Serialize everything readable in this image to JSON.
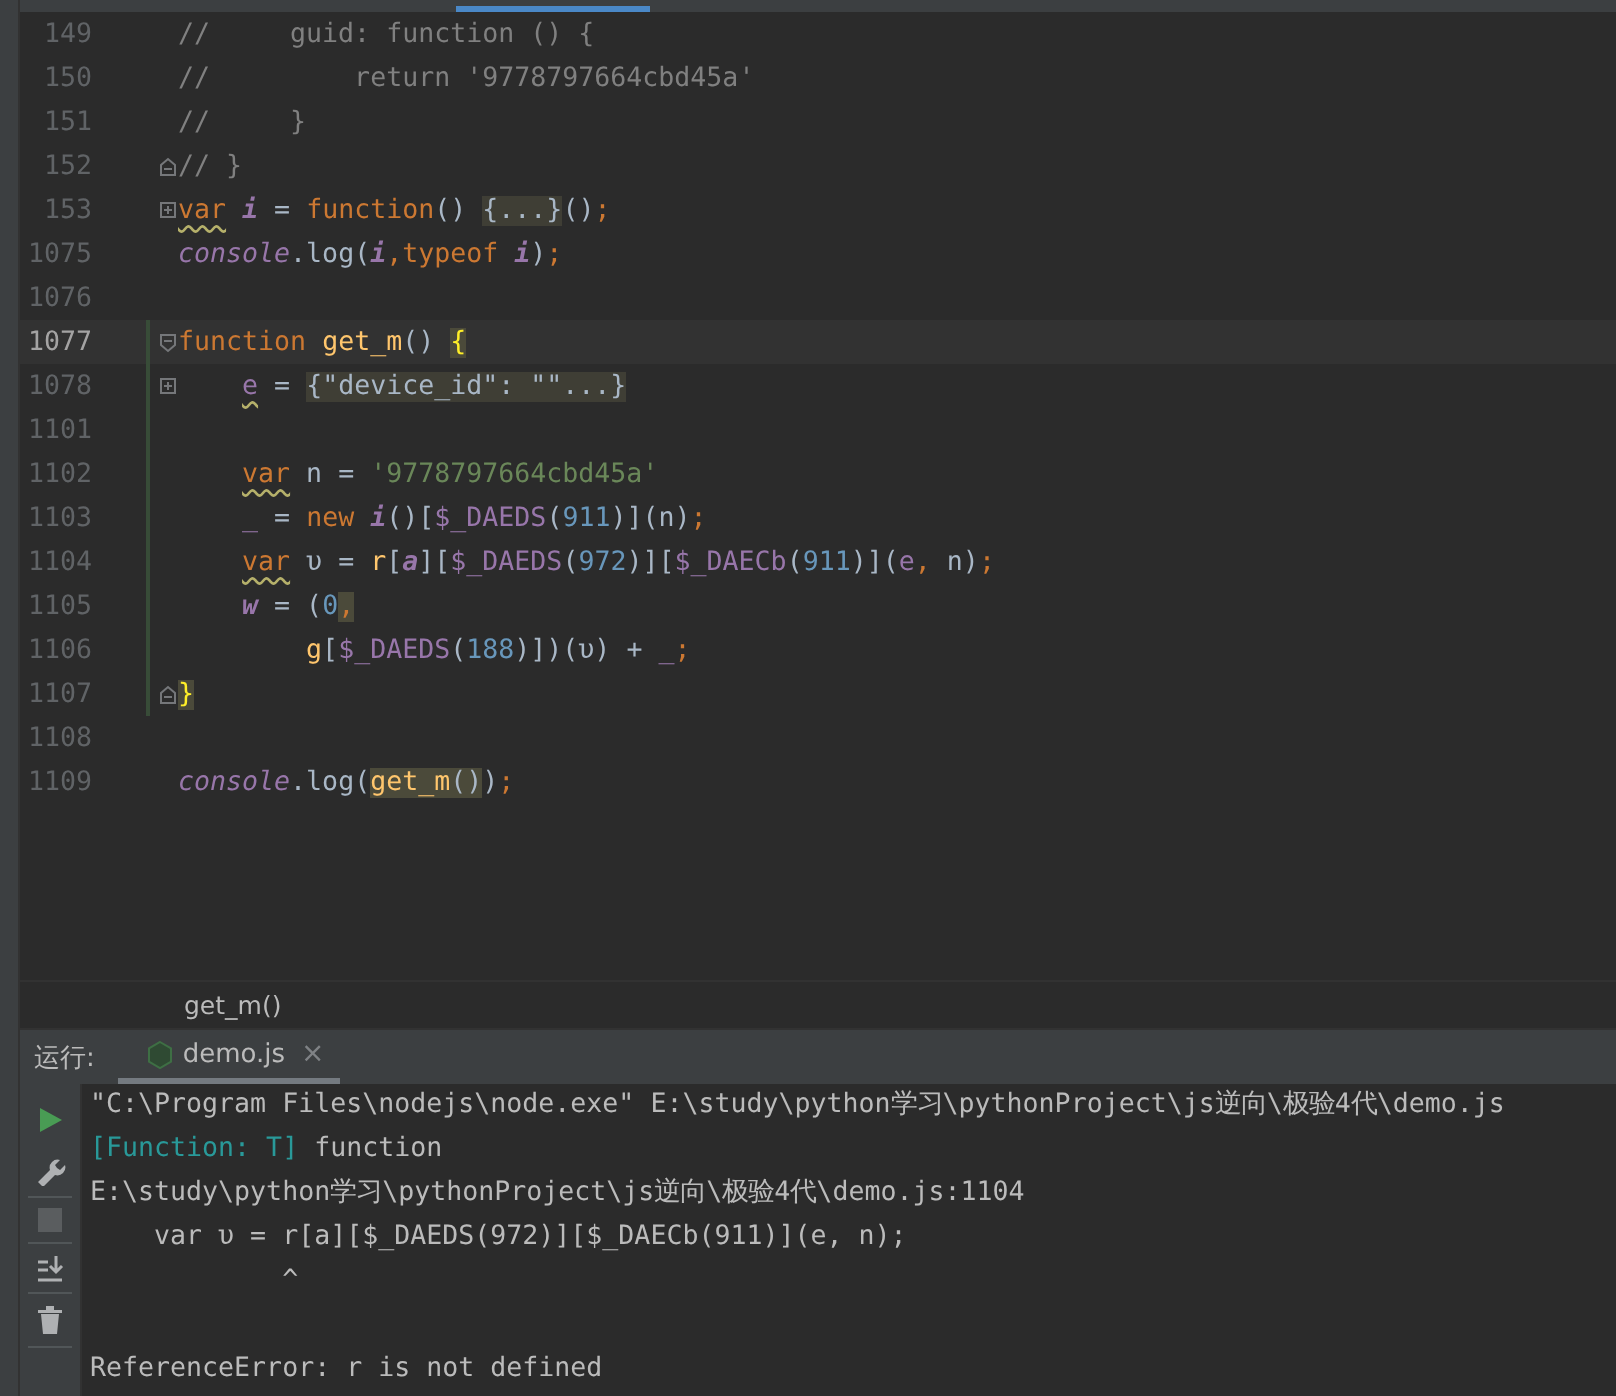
{
  "editor": {
    "lines": [
      {
        "number": "149",
        "current": false,
        "changed": false,
        "tokens": [
          {
            "text": "//     guid: function () {",
            "kind": "comment"
          }
        ]
      },
      {
        "number": "150",
        "current": false,
        "changed": false,
        "tokens": [
          {
            "text": "//         return '9778797664cbd45a'",
            "kind": "comment"
          }
        ]
      },
      {
        "number": "151",
        "current": false,
        "changed": false,
        "tokens": [
          {
            "text": "//     }",
            "kind": "comment"
          }
        ]
      },
      {
        "number": "152",
        "current": false,
        "changed": false,
        "fold": {
          "kind": "end"
        },
        "tokens": [
          {
            "text": "// }",
            "kind": "comment"
          }
        ]
      },
      {
        "number": "153",
        "current": false,
        "changed": false,
        "fold": {
          "kind": "expand"
        },
        "tokens": [
          {
            "text": "var",
            "kind": "keyword",
            "warning": true
          },
          {
            "text": " i",
            "kind": "local"
          },
          {
            "text": " = ",
            "kind": "text"
          },
          {
            "text": "function",
            "kind": "keyword"
          },
          {
            "text": "() ",
            "kind": "text"
          },
          {
            "text": "{...}",
            "kind": "folded"
          },
          {
            "text": "()",
            "kind": "text"
          },
          {
            "text": ";",
            "kind": "keyword"
          }
        ]
      },
      {
        "number": "1075",
        "current": false,
        "changed": false,
        "tokens": [
          {
            "text": "console",
            "kind": "global"
          },
          {
            "text": ".log(",
            "kind": "text"
          },
          {
            "text": "i",
            "kind": "local"
          },
          {
            "text": ",typeof ",
            "kind": "keyword"
          },
          {
            "text": "i",
            "kind": "local"
          },
          {
            "text": ")",
            "kind": "text"
          },
          {
            "text": ";",
            "kind": "keyword"
          }
        ]
      },
      {
        "number": "1076",
        "current": false,
        "changed": false
      },
      {
        "number": "1077",
        "current": true,
        "changed": true,
        "fold": {
          "kind": "collapse"
        },
        "tokens": [
          {
            "text": "function ",
            "kind": "keyword"
          },
          {
            "text": "get_m",
            "kind": "fn"
          },
          {
            "text": "() ",
            "kind": "text"
          },
          {
            "text": "{",
            "kind": "brace",
            "highlighted": true
          }
        ],
        "children": [
          {
            "number": "1078",
            "current": false,
            "changed": true,
            "fold": {
              "kind": "expand"
            },
            "tokens": [
              {
                "text": "e",
                "kind": "field",
                "warning": true
              },
              {
                "text": " = ",
                "kind": "text"
              },
              {
                "text": "{\"device_id\": \"\"...}",
                "kind": "folded"
              }
            ]
          },
          {
            "number": "1101",
            "current": false,
            "changed": true
          },
          {
            "number": "1102",
            "current": false,
            "changed": true,
            "tokens": [
              {
                "text": "var",
                "kind": "keyword",
                "warning": true
              },
              {
                "text": " n = ",
                "kind": "text"
              },
              {
                "text": "'9778797664cbd45a'",
                "kind": "string"
              }
            ]
          },
          {
            "number": "1103",
            "current": false,
            "changed": true,
            "tokens": [
              {
                "text": "_",
                "kind": "field"
              },
              {
                "text": " = ",
                "kind": "text"
              },
              {
                "text": "new ",
                "kind": "keyword"
              },
              {
                "text": "i",
                "kind": "local"
              },
              {
                "text": "()[",
                "kind": "text"
              },
              {
                "text": "$_DAEDS",
                "kind": "field"
              },
              {
                "text": "(",
                "kind": "text"
              },
              {
                "text": "911",
                "kind": "number"
              },
              {
                "text": ")](n)",
                "kind": "text"
              },
              {
                "text": ";",
                "kind": "keyword"
              }
            ]
          },
          {
            "number": "1104",
            "current": false,
            "changed": true,
            "tokens": [
              {
                "text": "var",
                "kind": "keyword",
                "warning": true
              },
              {
                "text": " υ = ",
                "kind": "text"
              },
              {
                "text": "r",
                "kind": "fn"
              },
              {
                "text": "[",
                "kind": "text"
              },
              {
                "text": "a",
                "kind": "local"
              },
              {
                "text": "][",
                "kind": "text"
              },
              {
                "text": "$_DAEDS",
                "kind": "field"
              },
              {
                "text": "(",
                "kind": "text"
              },
              {
                "text": "972",
                "kind": "number"
              },
              {
                "text": ")][",
                "kind": "text"
              },
              {
                "text": "$_DAECb",
                "kind": "field"
              },
              {
                "text": "(",
                "kind": "text"
              },
              {
                "text": "911",
                "kind": "number"
              },
              {
                "text": ")](",
                "kind": "text"
              },
              {
                "text": "e",
                "kind": "field"
              },
              {
                "text": ",",
                "kind": "keyword"
              },
              {
                "text": " n)",
                "kind": "text"
              },
              {
                "text": ";",
                "kind": "keyword"
              }
            ]
          },
          {
            "number": "1105",
            "current": false,
            "changed": true,
            "tokens": [
              {
                "text": "w",
                "kind": "local"
              },
              {
                "text": " = (",
                "kind": "text"
              },
              {
                "text": "0",
                "kind": "number"
              },
              {
                "text": ",",
                "kind": "keyword",
                "highlighted": true
              }
            ],
            "children": [
              {
                "number": "1106",
                "current": false,
                "changed": true,
                "tokens": [
                  {
                    "text": "g",
                    "kind": "fn"
                  },
                  {
                    "text": "[",
                    "kind": "text"
                  },
                  {
                    "text": "$_DAEDS",
                    "kind": "field"
                  },
                  {
                    "text": "(",
                    "kind": "text"
                  },
                  {
                    "text": "188",
                    "kind": "number"
                  },
                  {
                    "text": ")])(υ) + ",
                    "kind": "text"
                  },
                  {
                    "text": "_",
                    "kind": "field"
                  },
                  {
                    "text": ";",
                    "kind": "keyword"
                  }
                ]
              }
            ]
          }
        ]
      },
      {
        "number": "1107",
        "current": false,
        "changed": true,
        "fold": {
          "kind": "end"
        },
        "tokens": [
          {
            "text": "}",
            "kind": "brace",
            "highlighted": true
          }
        ]
      },
      {
        "number": "1108",
        "current": false,
        "changed": false
      },
      {
        "number": "1109",
        "current": false,
        "changed": false,
        "tokens": [
          {
            "text": "console",
            "kind": "global"
          },
          {
            "text": ".log(",
            "kind": "text"
          },
          {
            "text": "get_m",
            "kind": "fn",
            "highlighted": true
          },
          {
            "text": "()",
            "kind": "text",
            "highlighted": true
          },
          {
            "text": ")",
            "kind": "text"
          },
          {
            "text": ";",
            "kind": "keyword"
          }
        ]
      }
    ]
  },
  "breadcrumb": "get_m()",
  "run": {
    "label": "运行:",
    "tabs": [
      {
        "label": "demo.js",
        "selected": true,
        "close": "×"
      }
    ],
    "output": [
      {
        "tokens": [
          {
            "text": "\"C:\\Program Files\\nodejs\\node.exe\" E:\\study\\python学习\\pythonProject\\js逆向\\极验4代\\demo.js",
            "kind": "text"
          }
        ]
      },
      {
        "tokens": [
          {
            "text": "[Function: T]",
            "kind": "value"
          },
          {
            "text": " function",
            "kind": "text"
          }
        ]
      },
      {
        "tokens": [
          {
            "text": "E:\\study\\python学习\\pythonProject\\js逆向\\极验4代\\demo.js:1104",
            "kind": "text"
          }
        ]
      },
      {
        "tokens": [
          {
            "text": "    var υ = r[a][$_DAEDS(972)][$_DAECb(911)](e, n);",
            "kind": "text"
          }
        ]
      },
      {
        "tokens": [
          {
            "text": "            ^",
            "kind": "text"
          }
        ]
      },
      {
        "gap_before": true,
        "tokens": [
          {
            "text": "ReferenceError: r is not defined",
            "kind": "text"
          }
        ]
      }
    ]
  }
}
